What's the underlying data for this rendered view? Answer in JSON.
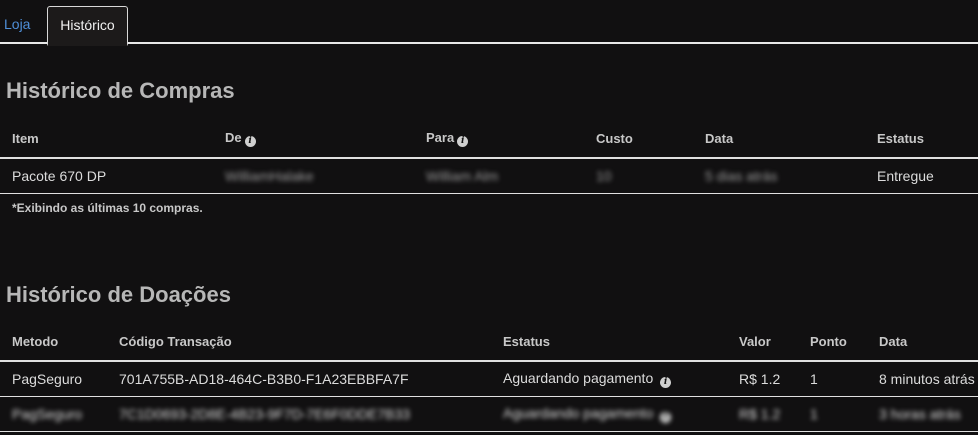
{
  "tabs": {
    "loja": "Loja",
    "historico": "Histórico"
  },
  "compras": {
    "title": "Histórico de Compras",
    "headers": {
      "item": "Item",
      "de": "De",
      "para": "Para",
      "custo": "Custo",
      "data": "Data",
      "estatus": "Estatus"
    },
    "row": {
      "item": "Pacote 670 DP",
      "de": "WilliamHalake",
      "para": "William Alm",
      "custo": "10",
      "data": "5 dias atrás",
      "estatus": "Entregue"
    },
    "note": "*Exibindo as últimas 10 compras."
  },
  "doacoes": {
    "title": "Histórico de Doações",
    "headers": {
      "metodo": "Metodo",
      "codigo": "Código Transação",
      "estatus": "Estatus",
      "valor": "Valor",
      "ponto": "Ponto",
      "data": "Data"
    },
    "rows": [
      {
        "metodo": "PagSeguro",
        "codigo": "701A755B-AD18-464C-B3B0-F1A23EBBFA7F",
        "estatus": "Aguardando pagamento",
        "valor": "R$ 1.2",
        "ponto": "1",
        "data": "8 minutos atrás"
      },
      {
        "metodo": "PagSeguro",
        "codigo": "7C1D0693-2D8E-4B23-9F7D-7E6F0DDE7B33",
        "estatus": "Aguardando pagamento",
        "valor": "R$ 1.2",
        "ponto": "1",
        "data": "3 horas atrás"
      }
    ]
  },
  "icons": {
    "info": "info-circle-icon"
  }
}
